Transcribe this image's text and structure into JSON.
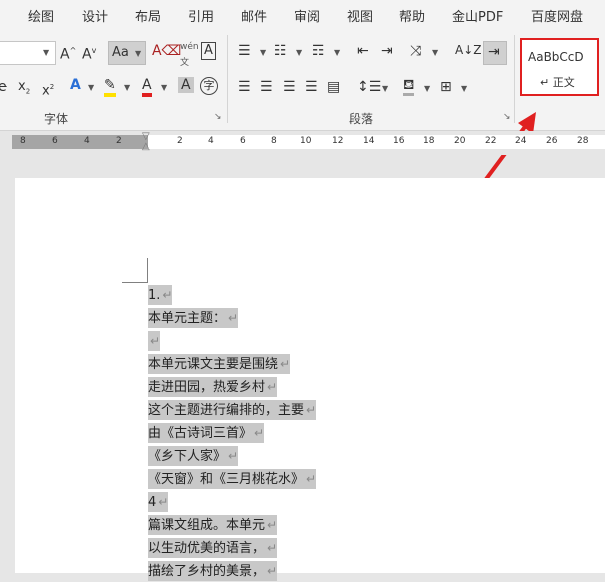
{
  "menu": [
    "绘图",
    "设计",
    "布局",
    "引用",
    "邮件",
    "审阅",
    "视图",
    "帮助",
    "金山PDF",
    "百度网盘"
  ],
  "ribbon": {
    "font_group_label": "字体",
    "paragraph_group_label": "段落",
    "style_preview": "AaBbCcD",
    "style_name": "↵ 正文"
  },
  "ruler_numbers": [
    "8",
    "6",
    "4",
    "2",
    "2",
    "4",
    "6",
    "8",
    "10",
    "12",
    "14",
    "16",
    "18",
    "20",
    "22",
    "24",
    "26",
    "28"
  ],
  "document": {
    "lines": [
      "1.",
      "本单元主题：",
      "",
      "本单元课文主要是围绕",
      "走进田园，热爱乡村",
      "这个主题进行编排的，主要",
      "由《古诗词三首》",
      "《乡下人家》",
      "《天窗》和《三月桃花水》",
      "4",
      "篇课文组成。本单元",
      "以生动优美的语言，",
      "描绘了乡村的美景，"
    ],
    "paragraph_mark": "↵"
  },
  "accent_color": "#e02020"
}
